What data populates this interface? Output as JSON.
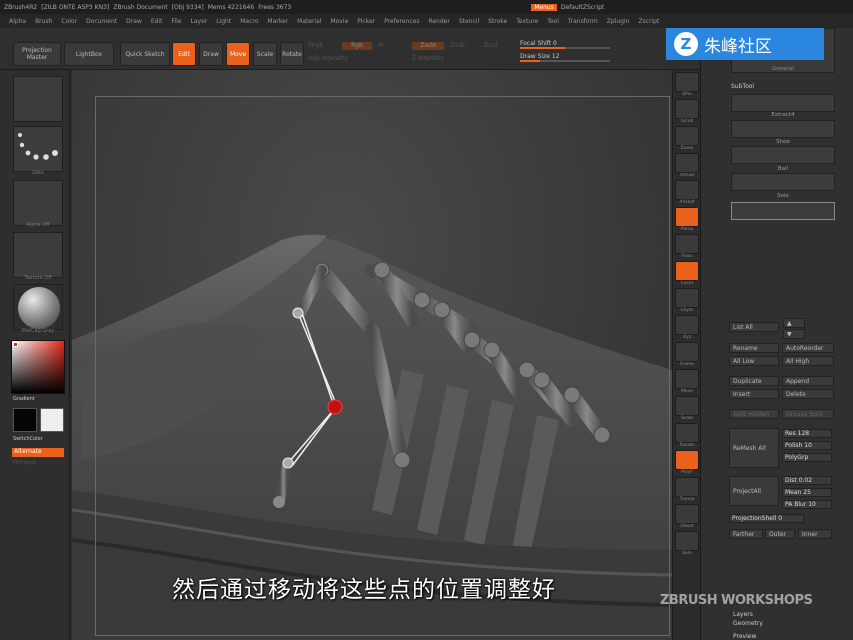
{
  "titlebar": {
    "app": "ZBrush4R2",
    "file": "[ZILB ONTE ASP3 KN3]",
    "doc": "ZBrush Document",
    "obj": "[Obj 9334]",
    "mem": "Mems 4221646",
    "free": "Frees 3673",
    "menus_label": "Menus",
    "script": "DefaultZScript"
  },
  "menubar": [
    "Alpha",
    "Brush",
    "Color",
    "Document",
    "Draw",
    "Edit",
    "File",
    "Layer",
    "Light",
    "Macro",
    "Marker",
    "Material",
    "Movie",
    "Picker",
    "Preferences",
    "Render",
    "Stencil",
    "Stroke",
    "Texture",
    "Tool",
    "Transform",
    "Zplugin",
    "Zscript"
  ],
  "toolbar": {
    "projection_master": "Projection Master",
    "lightbox": "LightBox",
    "quick_sketch": "Quick Sketch",
    "edit": "Edit",
    "draw": "Draw",
    "move": "Move",
    "scale": "Scale",
    "rotate": "Rotate",
    "mrgb": "Mrgb",
    "rgb": "Rgb",
    "m": "M",
    "zadd": "Zadd",
    "zsub": "Zsub",
    "zcut": "Zcut",
    "rgb_intensity": "Rgb Intensity",
    "z_intensity": "Z Intensity",
    "focal_shift_label": "Focal Shift",
    "focal_shift_value": "0",
    "focal_shift_fraction": 0.5,
    "draw_size_label": "Draw Size",
    "draw_size_value": "12",
    "draw_size_fraction": 0.22
  },
  "leftshelf": {
    "dots_caption": "Dots",
    "alpha_caption": "Alpha Off",
    "texture_caption": "Texture Off",
    "material_caption": "MatCap Gray",
    "gradient": "Gradient",
    "switch_color": "SwitchColor",
    "alternate": "Alternate",
    "vertex_fill": "FillObject"
  },
  "rightshelf": [
    "SPix",
    "Scroll",
    "Zoom",
    "Actual",
    "AAHalf",
    "Persp",
    "Floor",
    "Local",
    "LSym",
    "Xyz",
    "Frame",
    "Move",
    "Scale",
    "Rotate",
    "PolyF",
    "Transp",
    "Ghost",
    "Solo"
  ],
  "palette": {
    "subtool_title": "SubTool",
    "subtools": [
      "Extract4",
      "Shoe",
      "Ball",
      "Sole"
    ],
    "list_all": "List All",
    "rename": "Rename",
    "auto_reorder": "AutoReorder",
    "all_low": "All Low",
    "all_high": "All High",
    "duplicate": "Duplicate",
    "append": "Append",
    "insert": "Insert",
    "delete": "Delete",
    "split_hidden": "Split Hidden",
    "groups_split": "Groups Split",
    "remesh_all": "ReMesh All",
    "res_label": "Res",
    "res_value": "128",
    "polish_label": "Polish",
    "polish_value": "10",
    "polygrp": "PolyGrp",
    "project_all": "ProjectAll",
    "dist_label": "Dist",
    "dist_value": "0.02",
    "mean_label": "Mean",
    "mean_value": "25",
    "pa_blur_label": "PA Blur",
    "pa_blur_value": "10",
    "projection_shell_label": "ProjectionShell",
    "projection_shell_value": "0",
    "farther": "Farther",
    "outer": "Outer",
    "inner": "Inner",
    "layers": "Layers",
    "geometry": "Geometry",
    "preview": "Preview",
    "general": "General"
  },
  "logo": {
    "letter": "Z",
    "text": "朱峰社区"
  },
  "subtitle": "然后通过移动将这些点的位置调整好",
  "watermark": "ZBRUSH WORKSHOPS",
  "colors": {
    "accent": "#e9611a",
    "logo_blue": "#2b86e0"
  }
}
